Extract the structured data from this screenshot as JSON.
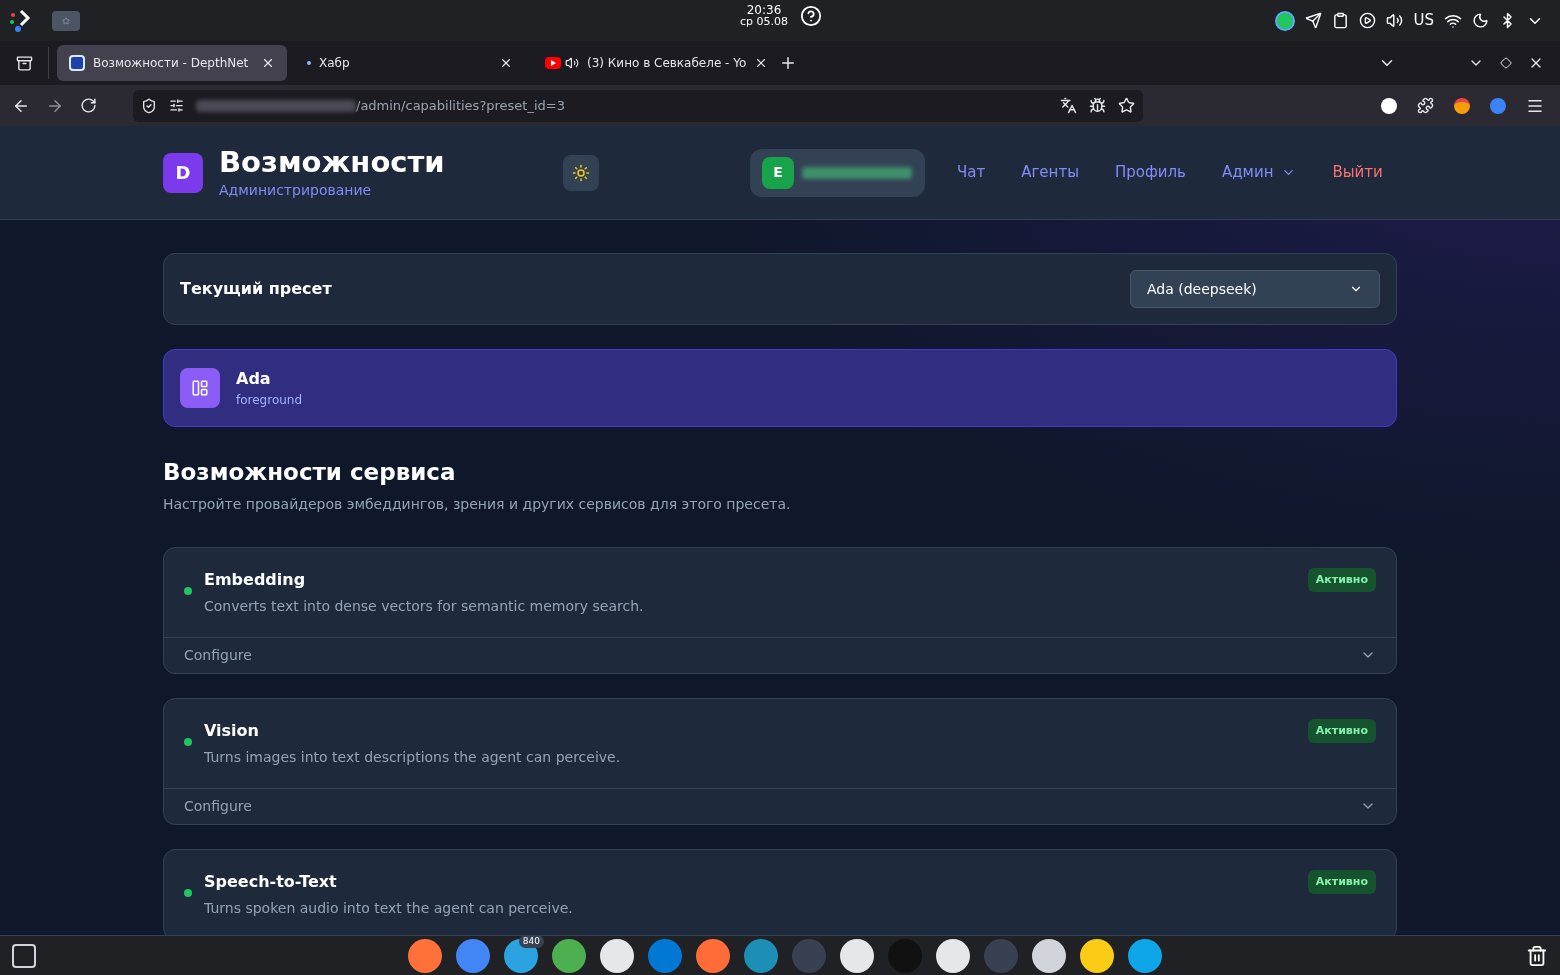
{
  "system_bar": {
    "time": "20:36",
    "date": "ср 05.08",
    "keyboard_layout": "US"
  },
  "browser": {
    "tabs": [
      {
        "title": "Возможности - DepthNet",
        "selected": true,
        "kind": "site"
      },
      {
        "title": "Хабр",
        "selected": false,
        "kind": "loading"
      },
      {
        "title": "(3) Кино в Севкабеле - Yo",
        "selected": false,
        "kind": "video"
      }
    ],
    "url": "/admin/capabilities?preset_id=3"
  },
  "header": {
    "logo_letter": "D",
    "title": "Возможности",
    "subtitle": "Администрирование",
    "user_initial": "E",
    "nav": [
      {
        "label": "Чат",
        "kind": "link"
      },
      {
        "label": "Агенты",
        "kind": "link"
      },
      {
        "label": "Профиль",
        "kind": "link"
      },
      {
        "label": "Админ",
        "kind": "menu"
      },
      {
        "label": "Выйти",
        "kind": "danger"
      }
    ]
  },
  "preset": {
    "label": "Текущий пресет",
    "value": "Ada (deepseek)"
  },
  "agent": {
    "name": "Ada",
    "mode": "foreground"
  },
  "section": {
    "title": "Возможности сервиса",
    "description": "Настройте провайдеров эмбеддингов, зрения и других сервисов для этого пресета."
  },
  "capabilities": [
    {
      "name": "Embedding",
      "description": "Converts text into dense vectors for semantic memory search.",
      "status": "Активно",
      "active": true,
      "configure": "Configure",
      "expanded": false
    },
    {
      "name": "Vision",
      "description": "Turns images into text descriptions the agent can perceive.",
      "status": "Активно",
      "active": true,
      "configure": "Configure",
      "expanded": false
    },
    {
      "name": "Speech-to-Text",
      "description": "Turns spoken audio into text the agent can perceive.",
      "status": "Активно",
      "active": true
    }
  ],
  "taskbar": {
    "badge": "840"
  }
}
